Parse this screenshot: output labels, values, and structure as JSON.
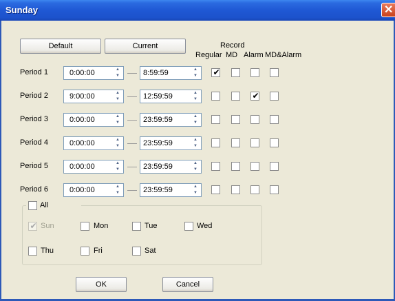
{
  "window": {
    "title": "Sunday",
    "close_glyph": "✕"
  },
  "buttons": {
    "default": "Default",
    "current": "Current",
    "ok": "OK",
    "cancel": "Cancel"
  },
  "record": {
    "heading": "Record",
    "columns": [
      "Regular",
      "MD",
      "Alarm",
      "MD&Alarm"
    ]
  },
  "periods": [
    {
      "label": "Period 1",
      "start": "0:00:00",
      "end": "8:59:59",
      "regular": true,
      "md": false,
      "alarm": false,
      "md_alarm": false
    },
    {
      "label": "Period 2",
      "start": "9:00:00",
      "end": "12:59:59",
      "regular": false,
      "md": false,
      "alarm": true,
      "md_alarm": false
    },
    {
      "label": "Period 3",
      "start": "0:00:00",
      "end": "23:59:59",
      "regular": false,
      "md": false,
      "alarm": false,
      "md_alarm": false
    },
    {
      "label": "Period 4",
      "start": "0:00:00",
      "end": "23:59:59",
      "regular": false,
      "md": false,
      "alarm": false,
      "md_alarm": false
    },
    {
      "label": "Period 5",
      "start": "0:00:00",
      "end": "23:59:59",
      "regular": false,
      "md": false,
      "alarm": false,
      "md_alarm": false
    },
    {
      "label": "Period 6",
      "start": "0:00:00",
      "end": "23:59:59",
      "regular": false,
      "md": false,
      "alarm": false,
      "md_alarm": false
    }
  ],
  "days": {
    "all_label": "All",
    "sun": "Sun",
    "mon": "Mon",
    "tue": "Tue",
    "wed": "Wed",
    "thu": "Thu",
    "fri": "Fri",
    "sat": "Sat"
  },
  "colors": {
    "title_bar": "#1f58d4",
    "checkmark": "#21a121",
    "window_bg": "#ece9d8"
  }
}
